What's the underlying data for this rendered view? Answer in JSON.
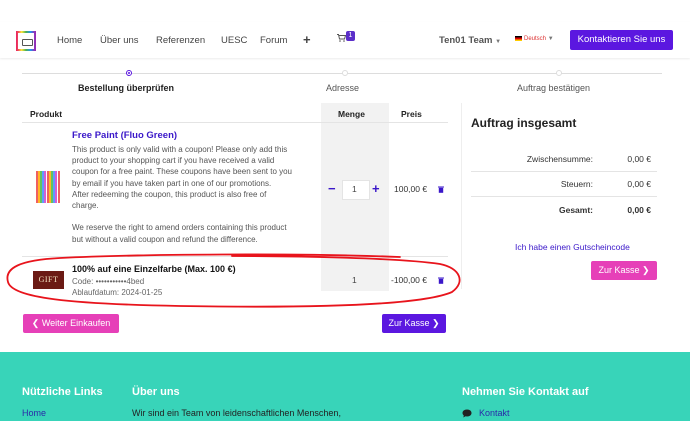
{
  "nav": {
    "links": [
      "Home",
      "Über uns",
      "Referenzen",
      "UESC",
      "Forum"
    ],
    "plus": "+",
    "cart_count": "1",
    "team": "Ten01 Team",
    "lang": "Deutsch",
    "contact_button": "Kontaktieren Sie uns"
  },
  "steps": [
    {
      "label": "Bestellung überprüfen",
      "active": true
    },
    {
      "label": "Adresse",
      "active": false
    },
    {
      "label": "Auftrag bestätigen",
      "active": false
    }
  ],
  "table": {
    "headers": {
      "product": "Produkt",
      "qty": "Menge",
      "price": "Preis"
    },
    "rows": [
      {
        "name": "Free Paint (Fluo Green)",
        "description": [
          "This product is only valid with a coupon! Please only add this",
          "product to your shopping cart if you have received a valid",
          "coupon for a free paint. These coupons have been sent to you",
          "by email if you have taken part in one of our promotions.",
          "After redeeming the coupon, this product is also free of",
          "charge.",
          "",
          "We reserve the right to amend orders containing this product",
          "but without a valid coupon and refund the difference."
        ],
        "minus": "−",
        "qty": "1",
        "plus": "+",
        "price": "100,00 €"
      },
      {
        "thumb_text": "GIFT",
        "name": "100% auf eine Einzelfarbe (Max. 100 €)",
        "code": "Code: •••••••••••4bed",
        "expiry": "Ablaufdatum: 2024-01-25",
        "qty": "1",
        "price": "-100,00 €"
      }
    ]
  },
  "summary": {
    "title": "Auftrag insgesamt",
    "subtotal_label": "Zwischensumme:",
    "subtotal": "0,00 €",
    "tax_label": "Steuern:",
    "tax": "0,00 €",
    "total_label": "Gesamt:",
    "total": "0,00 €",
    "coupon_link": "Ich habe einen Gutscheincode",
    "checkout_button": "Zur Kasse"
  },
  "actions": {
    "continue_shopping": "Weiter Einkaufen",
    "checkout": "Zur Kasse"
  },
  "footer": {
    "links_title": "Nützliche Links",
    "links_first": "Home",
    "about_title": "Über uns",
    "about_text": "Wir sind ein Team von leidenschaftlichen Menschen,",
    "contact_title": "Nehmen Sie Kontakt auf",
    "contact_link": "Kontakt"
  },
  "colors": {
    "brand_purple": "#5b17e0",
    "accent_pink": "#e640b8",
    "footer_teal": "#38d4b9",
    "annotation_red": "#e8141c"
  }
}
